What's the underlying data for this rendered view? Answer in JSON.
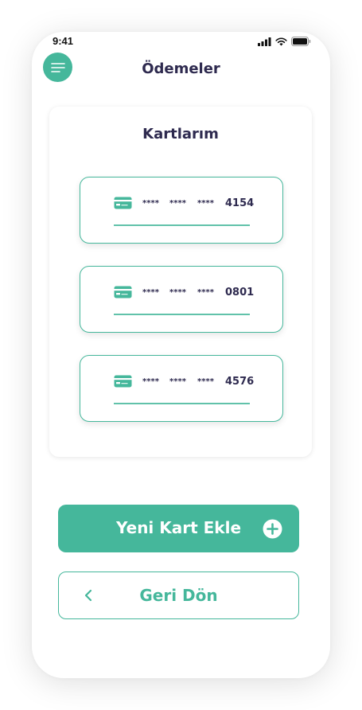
{
  "status_bar": {
    "time": "9:41"
  },
  "header": {
    "title": "Ödemeler",
    "menu_icon": "hamburger-menu-icon"
  },
  "cards_section": {
    "title": "Kartlarım",
    "cards": [
      {
        "masked": [
          "****",
          "****",
          "****"
        ],
        "last4": "4154",
        "icon": "credit-card-icon"
      },
      {
        "masked": [
          "****",
          "****",
          "****"
        ],
        "last4": "0801",
        "icon": "credit-card-icon"
      },
      {
        "masked": [
          "****",
          "****",
          "****"
        ],
        "last4": "4576",
        "icon": "credit-card-icon"
      }
    ]
  },
  "actions": {
    "add_card_label": "Yeni Kart Ekle",
    "add_card_icon": "plus-circle-icon",
    "back_label": "Geri Dön",
    "back_icon": "chevron-left-icon"
  },
  "colors": {
    "accent": "#45b79b",
    "text_dark": "#2e2a4f",
    "background": "#ffffff"
  }
}
